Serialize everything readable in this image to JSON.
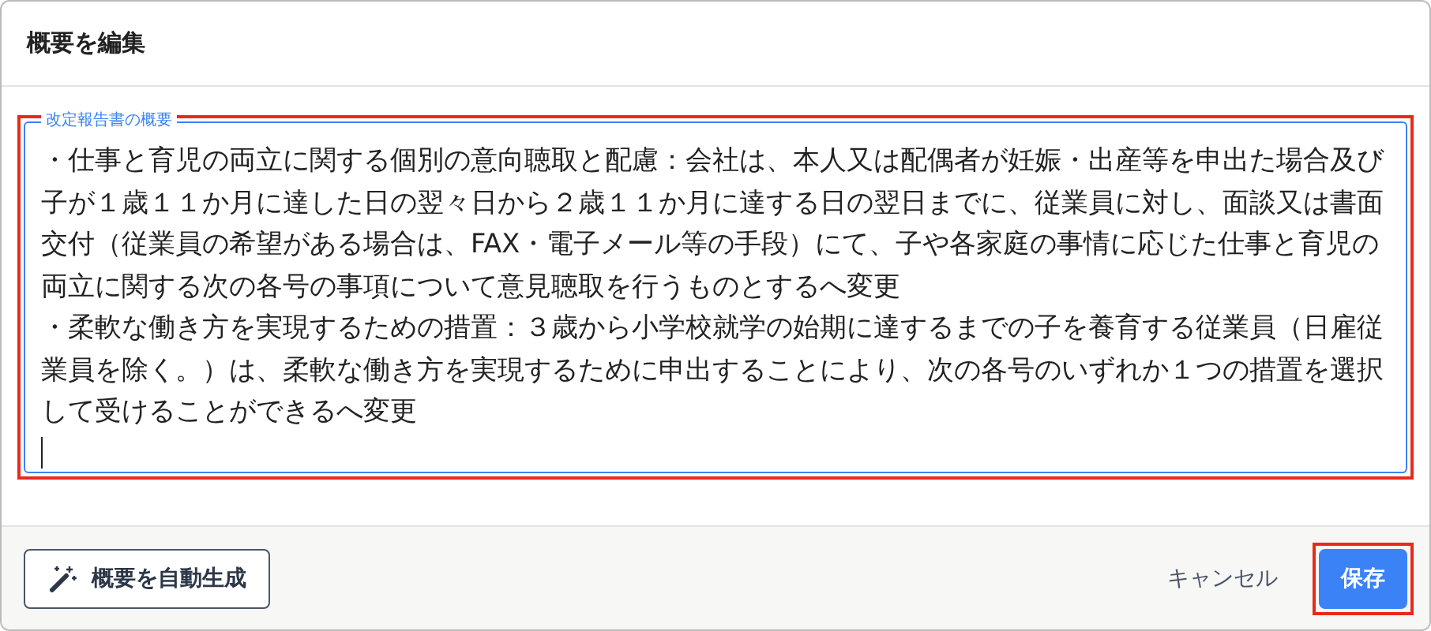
{
  "dialog": {
    "title": "概要を編集"
  },
  "summary": {
    "label": "改定報告書の概要",
    "paragraphs": [
      "・仕事と育児の両立に関する個別の意向聴取と配慮：会社は、本人又は配偶者が妊娠・出産等を申出た場合及び子が１歳１１か月に達した日の翌々日から２歳１１か月に達する日の翌日までに、従業員に対し、面談又は書面交付（従業員の希望がある場合は、FAX・電子メール等の手段）にて、子や各家庭の事情に応じた仕事と育児の両立に関する次の各号の事項について意見聴取を行うものとするへ変更",
      "・柔軟な働き方を実現するための措置：３歳から小学校就学の始期に達するまでの子を養育する従業員（日雇従業員を除く。）は、柔軟な働き方を実現するために申出することにより、次の各号のいずれか１つの措置を選択して受けることができるへ変更"
    ],
    "highlighted": true
  },
  "footer": {
    "generate_button": "概要を自動生成",
    "cancel_button": "キャンセル",
    "save_button": {
      "label": "保存",
      "highlighted": true
    }
  }
}
